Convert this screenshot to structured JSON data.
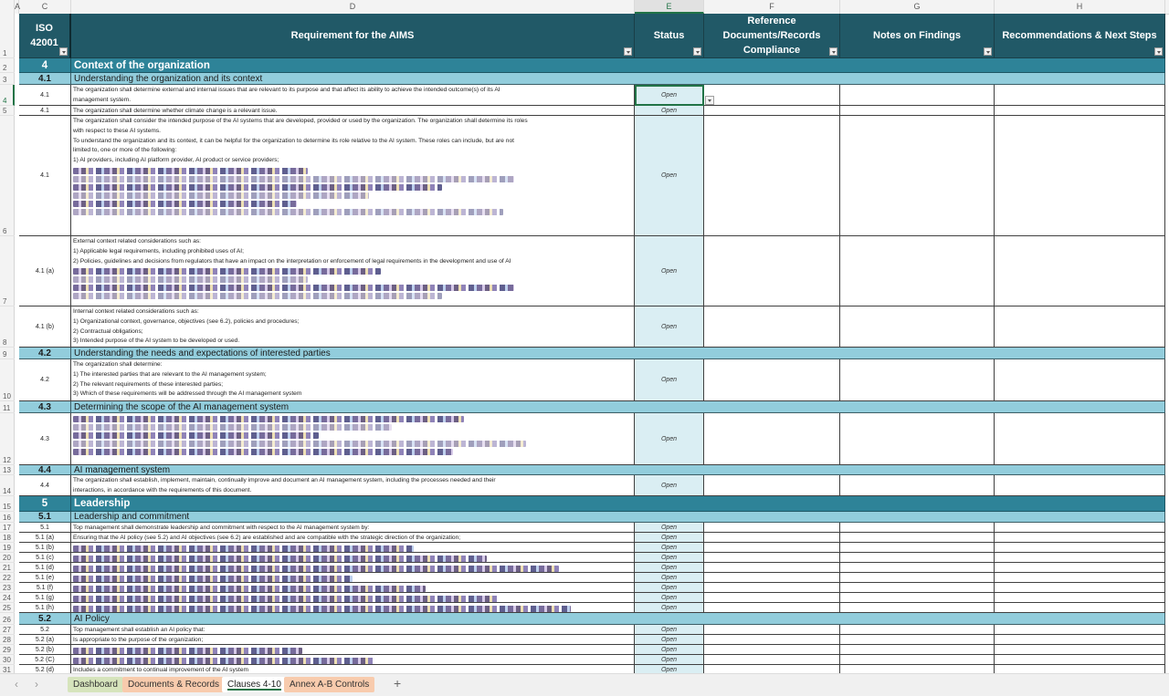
{
  "app": {
    "type": "spreadsheet",
    "active_cell": "E4",
    "active_row": "4"
  },
  "column_letters": [
    "A",
    "C",
    "D",
    "E",
    "F",
    "G",
    "H"
  ],
  "header": {
    "iso": "ISO 42001",
    "iso_line1": "ISO",
    "iso_line2": "42001",
    "requirement": "Requirement for the AIMS",
    "status": "Status",
    "reference_line1": "Reference",
    "reference_line2": "Documents/Records",
    "reference_line3": "Compliance",
    "notes": "Notes on Findings",
    "recommendations": "Recommendations & Next Steps"
  },
  "row_numbers": [
    "1",
    "2",
    "3",
    "4",
    "5",
    "6",
    "7",
    "8",
    "9",
    "10",
    "11",
    "12",
    "13",
    "14",
    "15",
    "16",
    "17",
    "18",
    "19",
    "20",
    "21",
    "22",
    "23",
    "24",
    "25",
    "26",
    "27",
    "28",
    "29",
    "30",
    "31"
  ],
  "rows": [
    {
      "type": "clause",
      "id": "4",
      "title": "Context of the organization"
    },
    {
      "type": "sub",
      "id": "4.1",
      "title": "Understanding the organization and its context"
    },
    {
      "type": "req",
      "id": "4.1",
      "status": "Open",
      "lines": [
        "The organization shall determine external and internal issues that are relevant to its purpose and that affect its ability to achieve the intended outcome(s) of its AI",
        "management system."
      ]
    },
    {
      "type": "req",
      "id": "4.1",
      "status": "Open",
      "lines": [
        "The organization shall determine whether climate change is a relevant issue."
      ]
    },
    {
      "type": "req",
      "id": "4.1",
      "status": "Open",
      "lines": [
        "The organization shall consider the intended purpose of the AI systems that are developed, provided or used by the organization. The organization shall determine its roles",
        "with respect to these AI systems.",
        "To understand the organization and its context, it can be helpful for the organization to determine its role relative to the AI system. These roles can include, but are not",
        "limited to, one or more of the following:",
        "1) AI providers, including AI platform provider, AI product or service providers;"
      ],
      "obscured_lines": 6
    },
    {
      "type": "req",
      "id": "4.1 (a)",
      "status": "Open",
      "lines": [
        "External context related considerations such as:",
        "1) Applicable legal requirements, including prohibited uses of AI;",
        "2) Policies, guidelines and decisions from regulators that have an impact on the interpretation or enforcement of legal requirements in the development and use of AI"
      ],
      "obscured_lines": 4
    },
    {
      "type": "req",
      "id": "4.1 (b)",
      "status": "Open",
      "lines": [
        "Internal context related considerations such as:",
        "1) Organizational context, governance, objectives (see 6.2), policies and procedures;",
        "2) Contractual obligations;",
        "3) Intended purpose of the AI system to be developed or used."
      ]
    },
    {
      "type": "sub",
      "id": "4.2",
      "title": "Understanding the needs and expectations of interested parties"
    },
    {
      "type": "req",
      "id": "4.2",
      "status": "Open",
      "lines": [
        "The organization shall determine:",
        "1) The interested parties that are relevant to the AI management system;",
        "2) The relevant requirements of these interested parties;",
        "3) Which of these requirements will be addressed through the AI management system"
      ]
    },
    {
      "type": "sub",
      "id": "4.3",
      "title": "Determining the scope of the AI management system"
    },
    {
      "type": "req",
      "id": "4.3",
      "status": "Open",
      "lines": [],
      "obscured_lines": 5
    },
    {
      "type": "sub",
      "id": "4.4",
      "title": "AI management system"
    },
    {
      "type": "req",
      "id": "4.4",
      "status": "Open",
      "lines": [
        "The organization shall establish, implement, maintain, continually improve and document an AI management system, including the processes needed and their",
        "interactions, in accordance with the requirements of this document."
      ]
    },
    {
      "type": "clause",
      "id": "5",
      "title": "Leadership"
    },
    {
      "type": "sub",
      "id": "5.1",
      "title": "Leadership and commitment"
    },
    {
      "type": "req",
      "id": "5.1",
      "status": "Open",
      "lines": [
        "Top management shall demonstrate leadership and commitment with respect to the AI management system by:"
      ]
    },
    {
      "type": "req",
      "id": "5.1 (a)",
      "status": "Open",
      "lines": [
        "Ensuring that the AI policy (see 5.2) and AI objectives (see 6.2) are established and are compatible with the strategic direction of the organization;"
      ]
    },
    {
      "type": "req",
      "id": "5.1 (b)",
      "status": "Open",
      "lines": [],
      "obscured_lines": 1
    },
    {
      "type": "req",
      "id": "5.1 (c)",
      "status": "Open",
      "lines": [],
      "obscured_lines": 1
    },
    {
      "type": "req",
      "id": "5.1 (d)",
      "status": "Open",
      "lines": [],
      "obscured_lines": 1
    },
    {
      "type": "req",
      "id": "5.1 (e)",
      "status": "Open",
      "lines": [],
      "obscured_lines": 1
    },
    {
      "type": "req",
      "id": "5.1 (f)",
      "status": "Open",
      "lines": [],
      "obscured_lines": 1
    },
    {
      "type": "req",
      "id": "5.1 (g)",
      "status": "Open",
      "lines": [],
      "obscured_lines": 1
    },
    {
      "type": "req",
      "id": "5.1 (h)",
      "status": "Open",
      "lines": [],
      "obscured_lines": 1
    },
    {
      "type": "sub",
      "id": "5.2",
      "title": "AI Policy"
    },
    {
      "type": "req",
      "id": "5.2",
      "status": "Open",
      "lines": [
        "Top management shall establish an AI policy that:"
      ]
    },
    {
      "type": "req",
      "id": "5.2 (a)",
      "status": "Open",
      "lines": [
        "Is appropriate to the purpose of the organization;"
      ]
    },
    {
      "type": "req",
      "id": "5.2 (b)",
      "status": "Open",
      "lines": [],
      "obscured_lines": 1
    },
    {
      "type": "req",
      "id": "5.2 (C)",
      "status": "Open",
      "lines": [],
      "obscured_lines": 1
    },
    {
      "type": "req",
      "id": "5.2 (d)",
      "status": "Open",
      "lines": [
        "Includes a commitment to continual improvement of the AI system"
      ]
    }
  ],
  "sheet_tabs": [
    {
      "label": "Dashboard",
      "color": "#d6e4bc",
      "active": false
    },
    {
      "label": "Documents & Records",
      "color": "#f8cbad",
      "active": false
    },
    {
      "label": "Clauses 4-10",
      "color": "#ffffff",
      "active": true
    },
    {
      "label": "Annex A-B Controls",
      "color": "#f8cbad",
      "active": false
    }
  ],
  "tab_nav": {
    "prev": "‹",
    "next": "›",
    "add": "+"
  },
  "colors": {
    "header_bg": "#215967",
    "clause_bg": "#2e8398",
    "subclause_bg": "#92cddc",
    "status_bg": "#daeef3",
    "selection": "#217346"
  }
}
